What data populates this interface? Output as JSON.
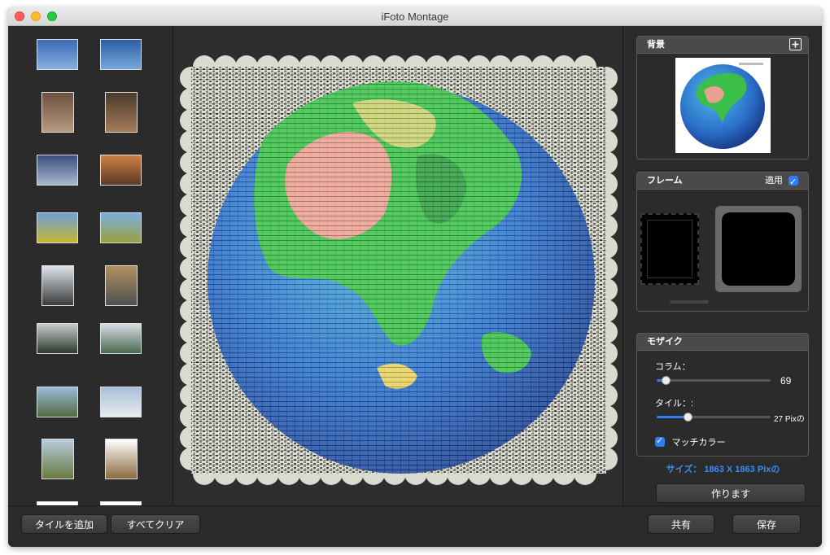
{
  "window": {
    "title": "iFoto Montage"
  },
  "thumbnails": [
    {
      "colors": [
        "#3e6ab5",
        "#88b0e0"
      ]
    },
    {
      "colors": [
        "#2a5ea6",
        "#7aa7d9"
      ]
    },
    {
      "colors": [
        "#6b5040",
        "#b89a80"
      ]
    },
    {
      "colors": [
        "#4a3a2c",
        "#a57c58"
      ]
    },
    {
      "colors": [
        "#3a4e7c",
        "#aab8d0"
      ]
    },
    {
      "colors": [
        "#d08040",
        "#5a3a28"
      ]
    },
    {
      "colors": [
        "#6ea0d8",
        "#c8b430"
      ]
    },
    {
      "colors": [
        "#7aaee0",
        "#9aa040"
      ]
    },
    {
      "colors": [
        "#dde4ea",
        "#3a3a3a"
      ]
    },
    {
      "colors": [
        "#b09060",
        "#505050"
      ]
    },
    {
      "colors": [
        "#c8ccd0",
        "#2a3a2c"
      ]
    },
    {
      "colors": [
        "#d8dde4",
        "#4a6a50"
      ]
    },
    {
      "colors": [
        "#9cbad8",
        "#506a40"
      ]
    },
    {
      "colors": [
        "#a8c0d8",
        "#e8ecf0"
      ]
    },
    {
      "colors": [
        "#b8cce0",
        "#6a7a40"
      ]
    },
    {
      "colors": [
        "#ffffff",
        "#8a6a40"
      ]
    }
  ],
  "background_panel": {
    "title": "背景",
    "add_icon": "plus-square-icon"
  },
  "frame_panel": {
    "title": "フレーム",
    "apply_label": "適用",
    "apply_checked": true
  },
  "mosaic_panel": {
    "title": "モザイク",
    "column_label": "コラム：",
    "column_value": "69",
    "column_fraction": 0.08,
    "tile_label": "タイル：:",
    "tile_value": "27 Pixの",
    "tile_fraction": 0.27,
    "match_color_label": "マッチカラー",
    "match_color_checked": true
  },
  "size_info": "サイズ： 1863 X 1863 Pixの",
  "buttons": {
    "create": "作ります",
    "add_tile": "タイルを追加",
    "clear_all": "すべてクリア",
    "share": "共有",
    "save": "保存"
  },
  "colors": {
    "accent": "#2f7ef5",
    "link": "#3b8df0"
  }
}
